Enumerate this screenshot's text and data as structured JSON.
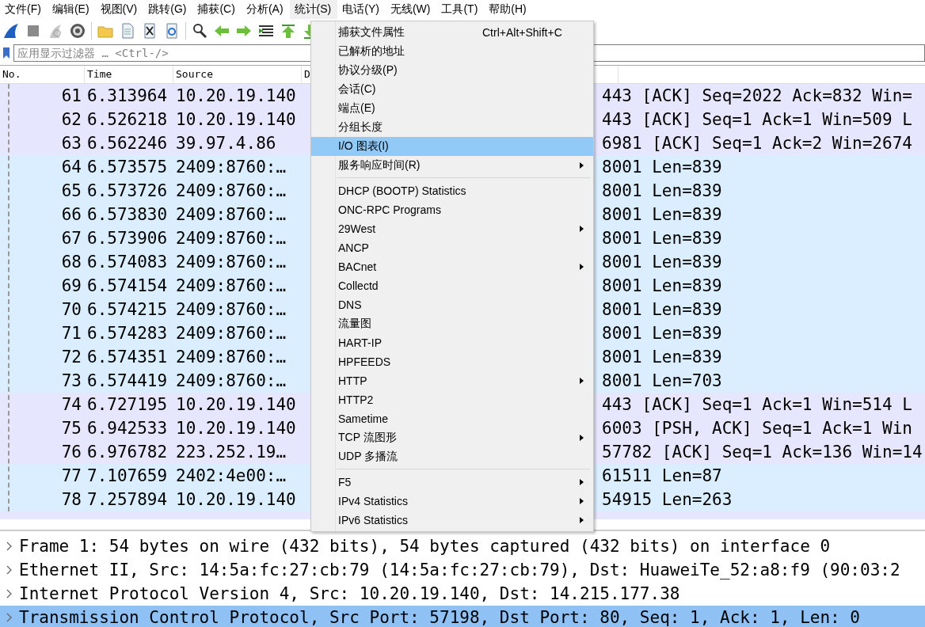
{
  "menubar": [
    {
      "label": "文件(F)",
      "selected": false
    },
    {
      "label": "编辑(E)",
      "selected": false
    },
    {
      "label": "视图(V)",
      "selected": false
    },
    {
      "label": "跳转(G)",
      "selected": false
    },
    {
      "label": "捕获(C)",
      "selected": false
    },
    {
      "label": "分析(A)",
      "selected": false
    },
    {
      "label": "统计(S)",
      "selected": true
    },
    {
      "label": "电话(Y)",
      "selected": false
    },
    {
      "label": "无线(W)",
      "selected": false
    },
    {
      "label": "工具(T)",
      "selected": false
    },
    {
      "label": "帮助(H)",
      "selected": false
    }
  ],
  "filter": {
    "placeholder": "应用显示过滤器 … <Ctrl-/>"
  },
  "packet_list": {
    "columns": [
      "No.",
      "Time",
      "Source",
      "D"
    ],
    "rows": [
      {
        "no": "61",
        "time": "6.313964",
        "source": "10.20.19.140",
        "info": "443 [ACK] Seq=2022 Ack=832 Win=",
        "color": "#e7e6ff"
      },
      {
        "no": "62",
        "time": "6.526218",
        "source": "10.20.19.140",
        "info": "443 [ACK] Seq=1 Ack=1 Win=509 L",
        "color": "#e7e6ff"
      },
      {
        "no": "63",
        "time": "6.562246",
        "source": "39.97.4.86",
        "info": "6981 [ACK] Seq=1 Ack=2 Win=2674",
        "color": "#e7e6ff"
      },
      {
        "no": "64",
        "time": "6.573575",
        "source": "2409:8760:…",
        "info": "8001 Len=839",
        "color": "#daeeff"
      },
      {
        "no": "65",
        "time": "6.573726",
        "source": "2409:8760:…",
        "info": "8001 Len=839",
        "color": "#daeeff"
      },
      {
        "no": "66",
        "time": "6.573830",
        "source": "2409:8760:…",
        "info": "8001 Len=839",
        "color": "#daeeff"
      },
      {
        "no": "67",
        "time": "6.573906",
        "source": "2409:8760:…",
        "info": "8001 Len=839",
        "color": "#daeeff"
      },
      {
        "no": "68",
        "time": "6.574083",
        "source": "2409:8760:…",
        "info": "8001 Len=839",
        "color": "#daeeff"
      },
      {
        "no": "69",
        "time": "6.574154",
        "source": "2409:8760:…",
        "info": "8001 Len=839",
        "color": "#daeeff"
      },
      {
        "no": "70",
        "time": "6.574215",
        "source": "2409:8760:…",
        "info": "8001 Len=839",
        "color": "#daeeff"
      },
      {
        "no": "71",
        "time": "6.574283",
        "source": "2409:8760:…",
        "info": "8001 Len=839",
        "color": "#daeeff"
      },
      {
        "no": "72",
        "time": "6.574351",
        "source": "2409:8760:…",
        "info": "8001 Len=839",
        "color": "#daeeff"
      },
      {
        "no": "73",
        "time": "6.574419",
        "source": "2409:8760:…",
        "info": "8001 Len=703",
        "color": "#daeeff"
      },
      {
        "no": "74",
        "time": "6.727195",
        "source": "10.20.19.140",
        "info": "443 [ACK] Seq=1 Ack=1 Win=514 L",
        "color": "#e7e6ff"
      },
      {
        "no": "75",
        "time": "6.942533",
        "source": "10.20.19.140",
        "info": "6003 [PSH, ACK] Seq=1 Ack=1 Win",
        "color": "#e7e6ff"
      },
      {
        "no": "76",
        "time": "6.976782",
        "source": "223.252.19…",
        "info": "57782 [ACK] Seq=1 Ack=136 Win=14",
        "color": "#e7e6ff"
      },
      {
        "no": "77",
        "time": "7.107659",
        "source": "2402:4e00:…",
        "info": "61511 Len=87",
        "color": "#daeeff"
      },
      {
        "no": "78",
        "time": "7.257894",
        "source": "10.20.19.140",
        "info": "54915 Len=263",
        "color": "#daeeff"
      }
    ]
  },
  "statistics_menu": [
    {
      "kind": "item",
      "label": "捕获文件属性",
      "shortcut": "Ctrl+Alt+Shift+C",
      "submenu": false,
      "selected": false
    },
    {
      "kind": "item",
      "label": "已解析的地址",
      "submenu": false,
      "selected": false
    },
    {
      "kind": "item",
      "label": "协议分级(P)",
      "submenu": false,
      "selected": false
    },
    {
      "kind": "item",
      "label": "会话(C)",
      "submenu": false,
      "selected": false
    },
    {
      "kind": "item",
      "label": "端点(E)",
      "submenu": false,
      "selected": false
    },
    {
      "kind": "item",
      "label": "分组长度",
      "submenu": false,
      "selected": false
    },
    {
      "kind": "item",
      "label": "I/O 图表(I)",
      "submenu": false,
      "selected": true
    },
    {
      "kind": "item",
      "label": "服务响应时间(R)",
      "submenu": true,
      "selected": false
    },
    {
      "kind": "separator"
    },
    {
      "kind": "item",
      "label": "DHCP (BOOTP) Statistics",
      "submenu": false,
      "selected": false
    },
    {
      "kind": "item",
      "label": "ONC-RPC Programs",
      "submenu": false,
      "selected": false
    },
    {
      "kind": "item",
      "label": "29West",
      "submenu": true,
      "selected": false
    },
    {
      "kind": "item",
      "label": "ANCP",
      "submenu": false,
      "selected": false
    },
    {
      "kind": "item",
      "label": "BACnet",
      "submenu": true,
      "selected": false
    },
    {
      "kind": "item",
      "label": "Collectd",
      "submenu": false,
      "selected": false
    },
    {
      "kind": "item",
      "label": "DNS",
      "submenu": false,
      "selected": false
    },
    {
      "kind": "item",
      "label": "流量图",
      "submenu": false,
      "selected": false
    },
    {
      "kind": "item",
      "label": "HART-IP",
      "submenu": false,
      "selected": false
    },
    {
      "kind": "item",
      "label": "HPFEEDS",
      "submenu": false,
      "selected": false
    },
    {
      "kind": "item",
      "label": "HTTP",
      "submenu": true,
      "selected": false
    },
    {
      "kind": "item",
      "label": "HTTP2",
      "submenu": false,
      "selected": false
    },
    {
      "kind": "item",
      "label": "Sametime",
      "submenu": false,
      "selected": false
    },
    {
      "kind": "item",
      "label": "TCP 流图形",
      "submenu": true,
      "selected": false
    },
    {
      "kind": "item",
      "label": "UDP 多播流",
      "submenu": false,
      "selected": false
    },
    {
      "kind": "separator"
    },
    {
      "kind": "item",
      "label": "F5",
      "submenu": true,
      "selected": false
    },
    {
      "kind": "item",
      "label": "IPv4 Statistics",
      "submenu": true,
      "selected": false
    },
    {
      "kind": "item",
      "label": "IPv6 Statistics",
      "submenu": true,
      "selected": false
    }
  ],
  "packet_details": [
    {
      "text": "Frame 1: 54 bytes on wire (432 bits), 54 bytes captured (432 bits) on interface 0",
      "expanded": false,
      "selected": false
    },
    {
      "text": "Ethernet II, Src: 14:5a:fc:27:cb:79 (14:5a:fc:27:cb:79), Dst: HuaweiTe_52:a8:f9 (90:03:2",
      "expanded": false,
      "selected": false
    },
    {
      "text": "Internet Protocol Version 4, Src: 10.20.19.140, Dst: 14.215.177.38",
      "expanded": false,
      "selected": false
    },
    {
      "text": "Transmission Control Protocol, Src Port: 57198, Dst Port: 80, Seq: 1, Ack: 1, Len: 0",
      "expanded": false,
      "selected": true
    }
  ]
}
